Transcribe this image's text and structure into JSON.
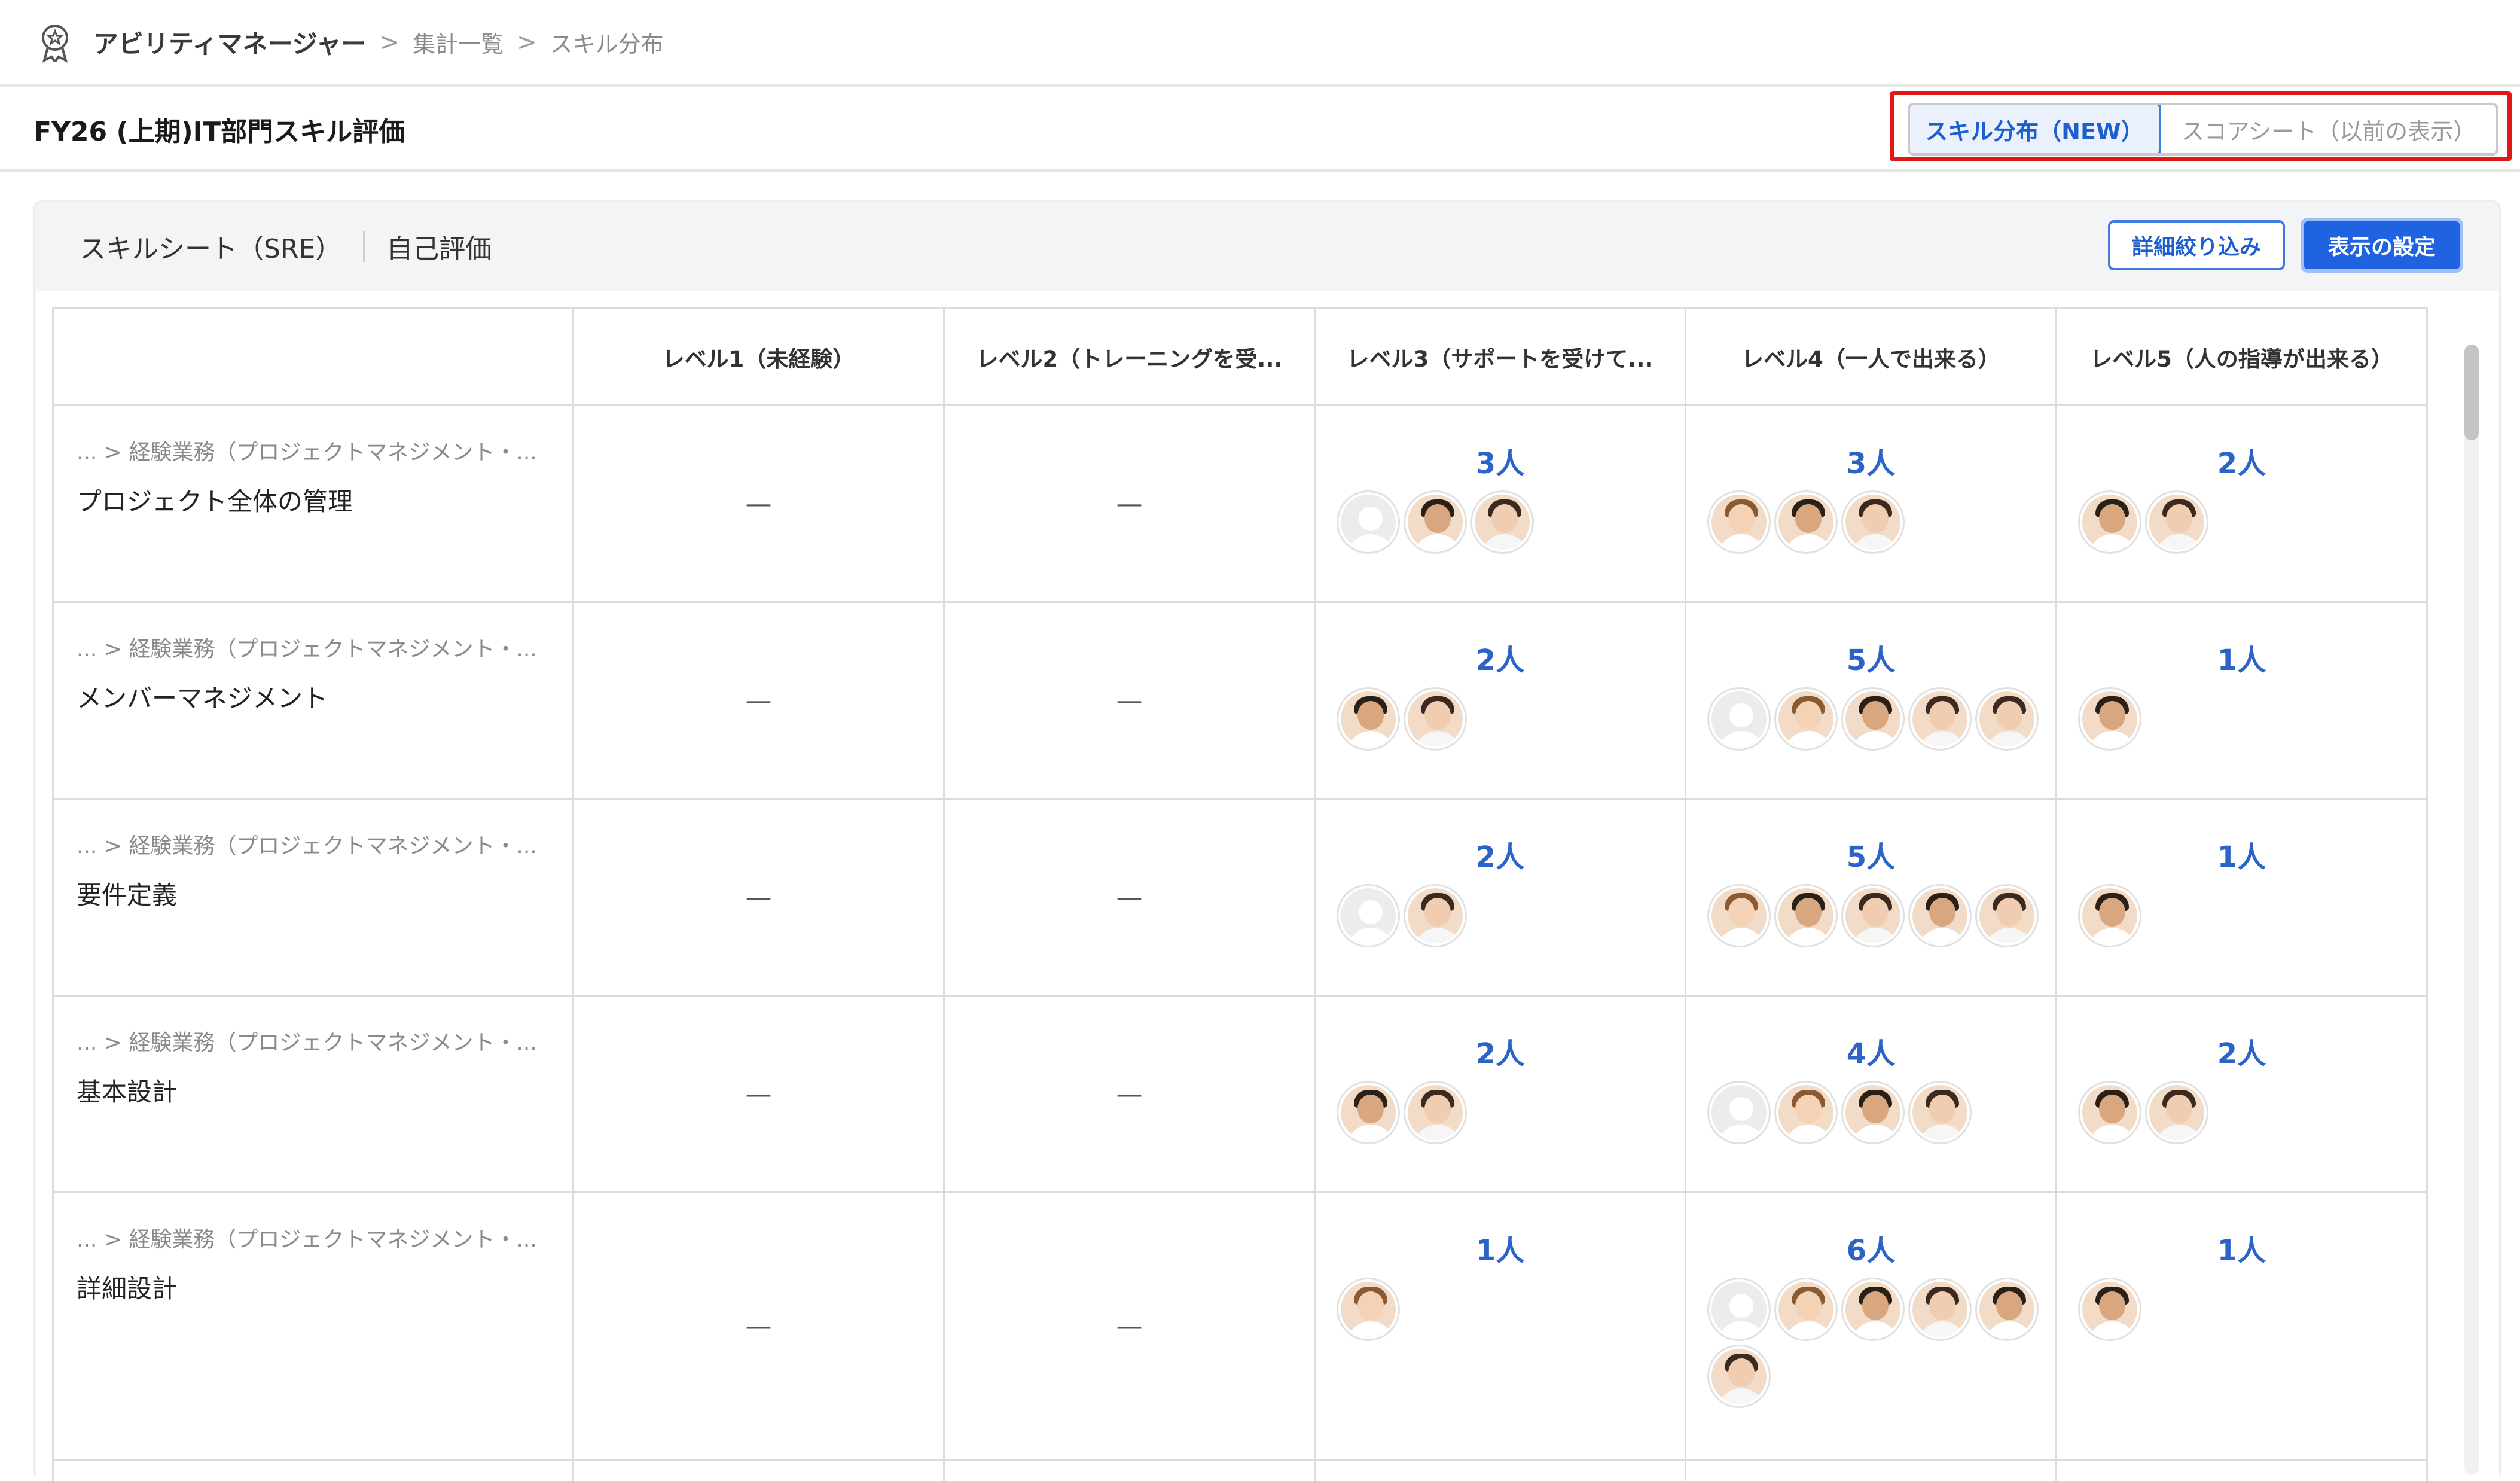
{
  "breadcrumb": {
    "app_icon": "award-ribbon-icon",
    "app": "アビリティマネージャー",
    "separator": ">",
    "items": [
      "集計一覧",
      "スキル分布"
    ]
  },
  "page": {
    "title": "FY26 (上期)IT部門スキル評価"
  },
  "view_switch": {
    "active_label": "スキル分布（NEW）",
    "inactive_label": "スコアシート（以前の表示）"
  },
  "panel": {
    "sheet_name": "スキルシート（SRE）",
    "eval_type": "自己評価",
    "filter_button": "詳細絞り込み",
    "display_button": "表示の設定"
  },
  "table": {
    "headers": [
      "",
      "レベル1（未経験）",
      "レベル2（トレーニングを受...",
      "レベル3（サポートを受けて...",
      "レベル4（一人で出来る）",
      "レベル5（人の指導が出来る）"
    ],
    "empty_mark": "—",
    "rows": [
      {
        "path": "... > 経験業務（プロジェクトマネジメント・...",
        "name": "プロジェクト全体の管理",
        "levels": [
          null,
          null,
          {
            "count": "3人",
            "avatars": [
              "anon",
              "m-dark",
              "m-light"
            ]
          },
          {
            "count": "3人",
            "avatars": [
              "f-brown",
              "m-dark",
              "m-light"
            ]
          },
          {
            "count": "2人",
            "avatars": [
              "m-dark",
              "m-light"
            ]
          }
        ]
      },
      {
        "path": "... > 経験業務（プロジェクトマネジメント・...",
        "name": "メンバーマネジメント",
        "levels": [
          null,
          null,
          {
            "count": "2人",
            "avatars": [
              "m-dark",
              "m-light"
            ]
          },
          {
            "count": "5人",
            "avatars": [
              "anon",
              "f-brown",
              "m-dark",
              "m-light",
              "m-light"
            ]
          },
          {
            "count": "1人",
            "avatars": [
              "m-dark"
            ]
          }
        ]
      },
      {
        "path": "... > 経験業務（プロジェクトマネジメント・...",
        "name": "要件定義",
        "levels": [
          null,
          null,
          {
            "count": "2人",
            "avatars": [
              "anon",
              "m-light"
            ]
          },
          {
            "count": "5人",
            "avatars": [
              "f-brown",
              "m-dark",
              "m-light",
              "m-dark",
              "m-light"
            ]
          },
          {
            "count": "1人",
            "avatars": [
              "m-dark"
            ]
          }
        ]
      },
      {
        "path": "... > 経験業務（プロジェクトマネジメント・...",
        "name": "基本設計",
        "levels": [
          null,
          null,
          {
            "count": "2人",
            "avatars": [
              "m-dark",
              "m-light"
            ]
          },
          {
            "count": "4人",
            "avatars": [
              "anon",
              "f-brown",
              "m-dark",
              "m-light"
            ]
          },
          {
            "count": "2人",
            "avatars": [
              "m-dark",
              "m-light"
            ]
          }
        ]
      },
      {
        "path": "... > 経験業務（プロジェクトマネジメント・...",
        "name": "詳細設計",
        "levels": [
          null,
          null,
          {
            "count": "1人",
            "avatars": [
              "f-brown"
            ]
          },
          {
            "count": "6人",
            "avatars": [
              "anon",
              "f-brown",
              "m-dark",
              "m-light",
              "m-dark",
              "m-light"
            ]
          },
          {
            "count": "1人",
            "avatars": [
              "m-dark"
            ]
          }
        ]
      }
    ]
  },
  "colors": {
    "accent": "#2c63c7",
    "primary_button": "#1f63e0",
    "highlight_box": "#e01818"
  }
}
